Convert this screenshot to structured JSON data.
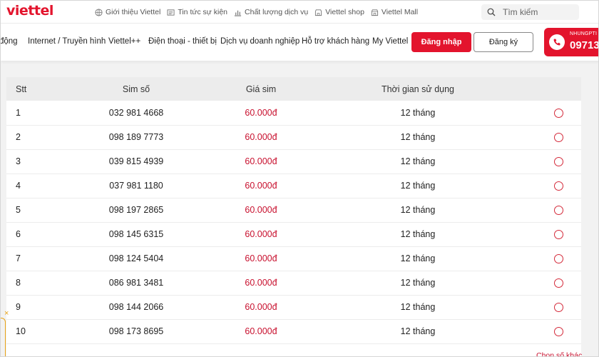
{
  "brand": {
    "logo_text": "viettel",
    "accent_color": "#e3142d",
    "price_color": "#c8102e"
  },
  "utility_links": [
    {
      "icon": "globe-icon",
      "label": "Giới thiệu Viettel"
    },
    {
      "icon": "newspaper-icon",
      "label": "Tin tức sự kiện"
    },
    {
      "icon": "chart-icon",
      "label": "Chất lượng dịch vụ"
    },
    {
      "icon": "shop-icon",
      "label": "Viettel shop"
    },
    {
      "icon": "store-icon",
      "label": "Viettel Mall"
    }
  ],
  "search": {
    "placeholder": "Tìm kiếm",
    "icon": "search-icon"
  },
  "nav": {
    "items": [
      "động",
      "Internet / Truyền hình",
      "Viettel++",
      "Điện thoại - thiết bị",
      "Dịch vụ doanh nghiệp",
      "Hỗ trợ khách hàng",
      "My Viettel"
    ],
    "login_label": "Đăng nhập",
    "register_label": "Đăng ký",
    "hotline_label": "NHUNGPTI",
    "hotline_number": "09713",
    "hotline_icon": "phone-icon"
  },
  "table": {
    "headers": {
      "stt": "Stt",
      "sim": "Sim số",
      "price": "Giá sim",
      "duration": "Thời gian sử dụng"
    },
    "rows": [
      {
        "stt": "1",
        "sim": "032 981 4668",
        "price": "60.000đ",
        "duration": "12 tháng"
      },
      {
        "stt": "2",
        "sim": "098 189 7773",
        "price": "60.000đ",
        "duration": "12 tháng"
      },
      {
        "stt": "3",
        "sim": "039 815 4939",
        "price": "60.000đ",
        "duration": "12 tháng"
      },
      {
        "stt": "4",
        "sim": "037 981 1180",
        "price": "60.000đ",
        "duration": "12 tháng"
      },
      {
        "stt": "5",
        "sim": "098 197 2865",
        "price": "60.000đ",
        "duration": "12 tháng"
      },
      {
        "stt": "6",
        "sim": "098 145 6315",
        "price": "60.000đ",
        "duration": "12 tháng"
      },
      {
        "stt": "7",
        "sim": "098 124 5404",
        "price": "60.000đ",
        "duration": "12 tháng"
      },
      {
        "stt": "8",
        "sim": "086 981 3481",
        "price": "60.000đ",
        "duration": "12 tháng"
      },
      {
        "stt": "9",
        "sim": "098 144 2066",
        "price": "60.000đ",
        "duration": "12 tháng"
      },
      {
        "stt": "10",
        "sim": "098 173 8695",
        "price": "60.000đ",
        "duration": "12 tháng"
      }
    ],
    "more_link": "Chọn số khác"
  },
  "floating": {
    "close_glyph": "×"
  }
}
